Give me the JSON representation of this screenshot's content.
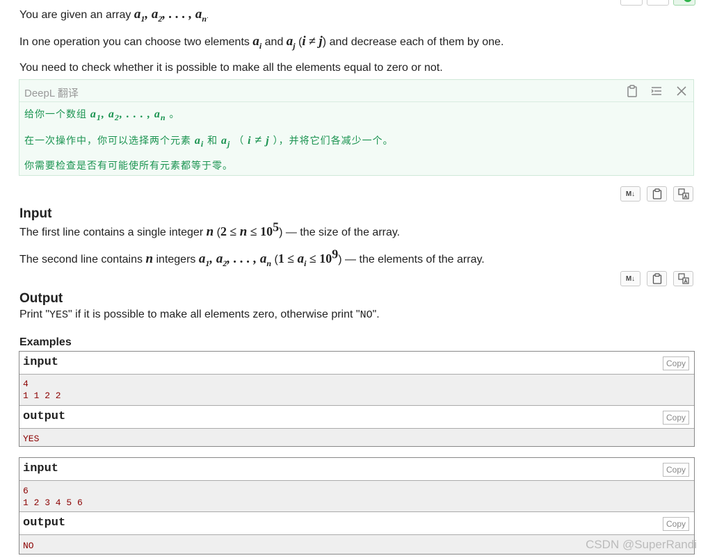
{
  "statement": {
    "line1_prefix": "You are given an array",
    "line2_prefix": "In one operation you can choose two elements",
    "line2_and": "and",
    "line2_suffix": "and decrease each of them by one.",
    "line3": "You need to check whether it is possible to make all the elements equal to zero or not."
  },
  "deepl": {
    "title": "DeepL 翻译",
    "zh_line1_prefix": "给你一个数组",
    "zh_line2_prefix": "在一次操作中，你可以选择两个元素",
    "zh_line2_and": "和",
    "zh_line2_suffix": "，并将它们各减少一个。",
    "zh_line3": "你需要检查是否有可能使所有元素都等于零。",
    "icons": [
      "clipboard-icon",
      "list-icon",
      "close-icon"
    ]
  },
  "toolbar": {
    "md_label": "M↓"
  },
  "input_section": {
    "title": "Input",
    "line1_prefix": "The first line contains a single integer",
    "line1_suffix": "— the size of the array.",
    "line2_prefix": "The second line contains",
    "line2_mid": "integers",
    "line2_suffix": "— the elements of the array."
  },
  "output_section": {
    "title": "Output",
    "text_prefix": "Print \"",
    "yes": "YES",
    "text_mid": "\" if it is possible to make all elements zero, otherwise print \"",
    "no": "NO",
    "text_suffix": "\"."
  },
  "examples": {
    "title": "Examples",
    "copy_label": "Copy",
    "input_label": "input",
    "output_label": "output",
    "items": [
      {
        "input": "4\n1 1 2 2",
        "output": "YES"
      },
      {
        "input": "6\n1 2 3 4 5 6",
        "output": "NO"
      }
    ]
  },
  "watermark": "CSDN @SuperRandi",
  "colors": {
    "deepl_text": "#1a9350",
    "example_text": "#8b0000",
    "accent_green": "#2fb34a"
  }
}
